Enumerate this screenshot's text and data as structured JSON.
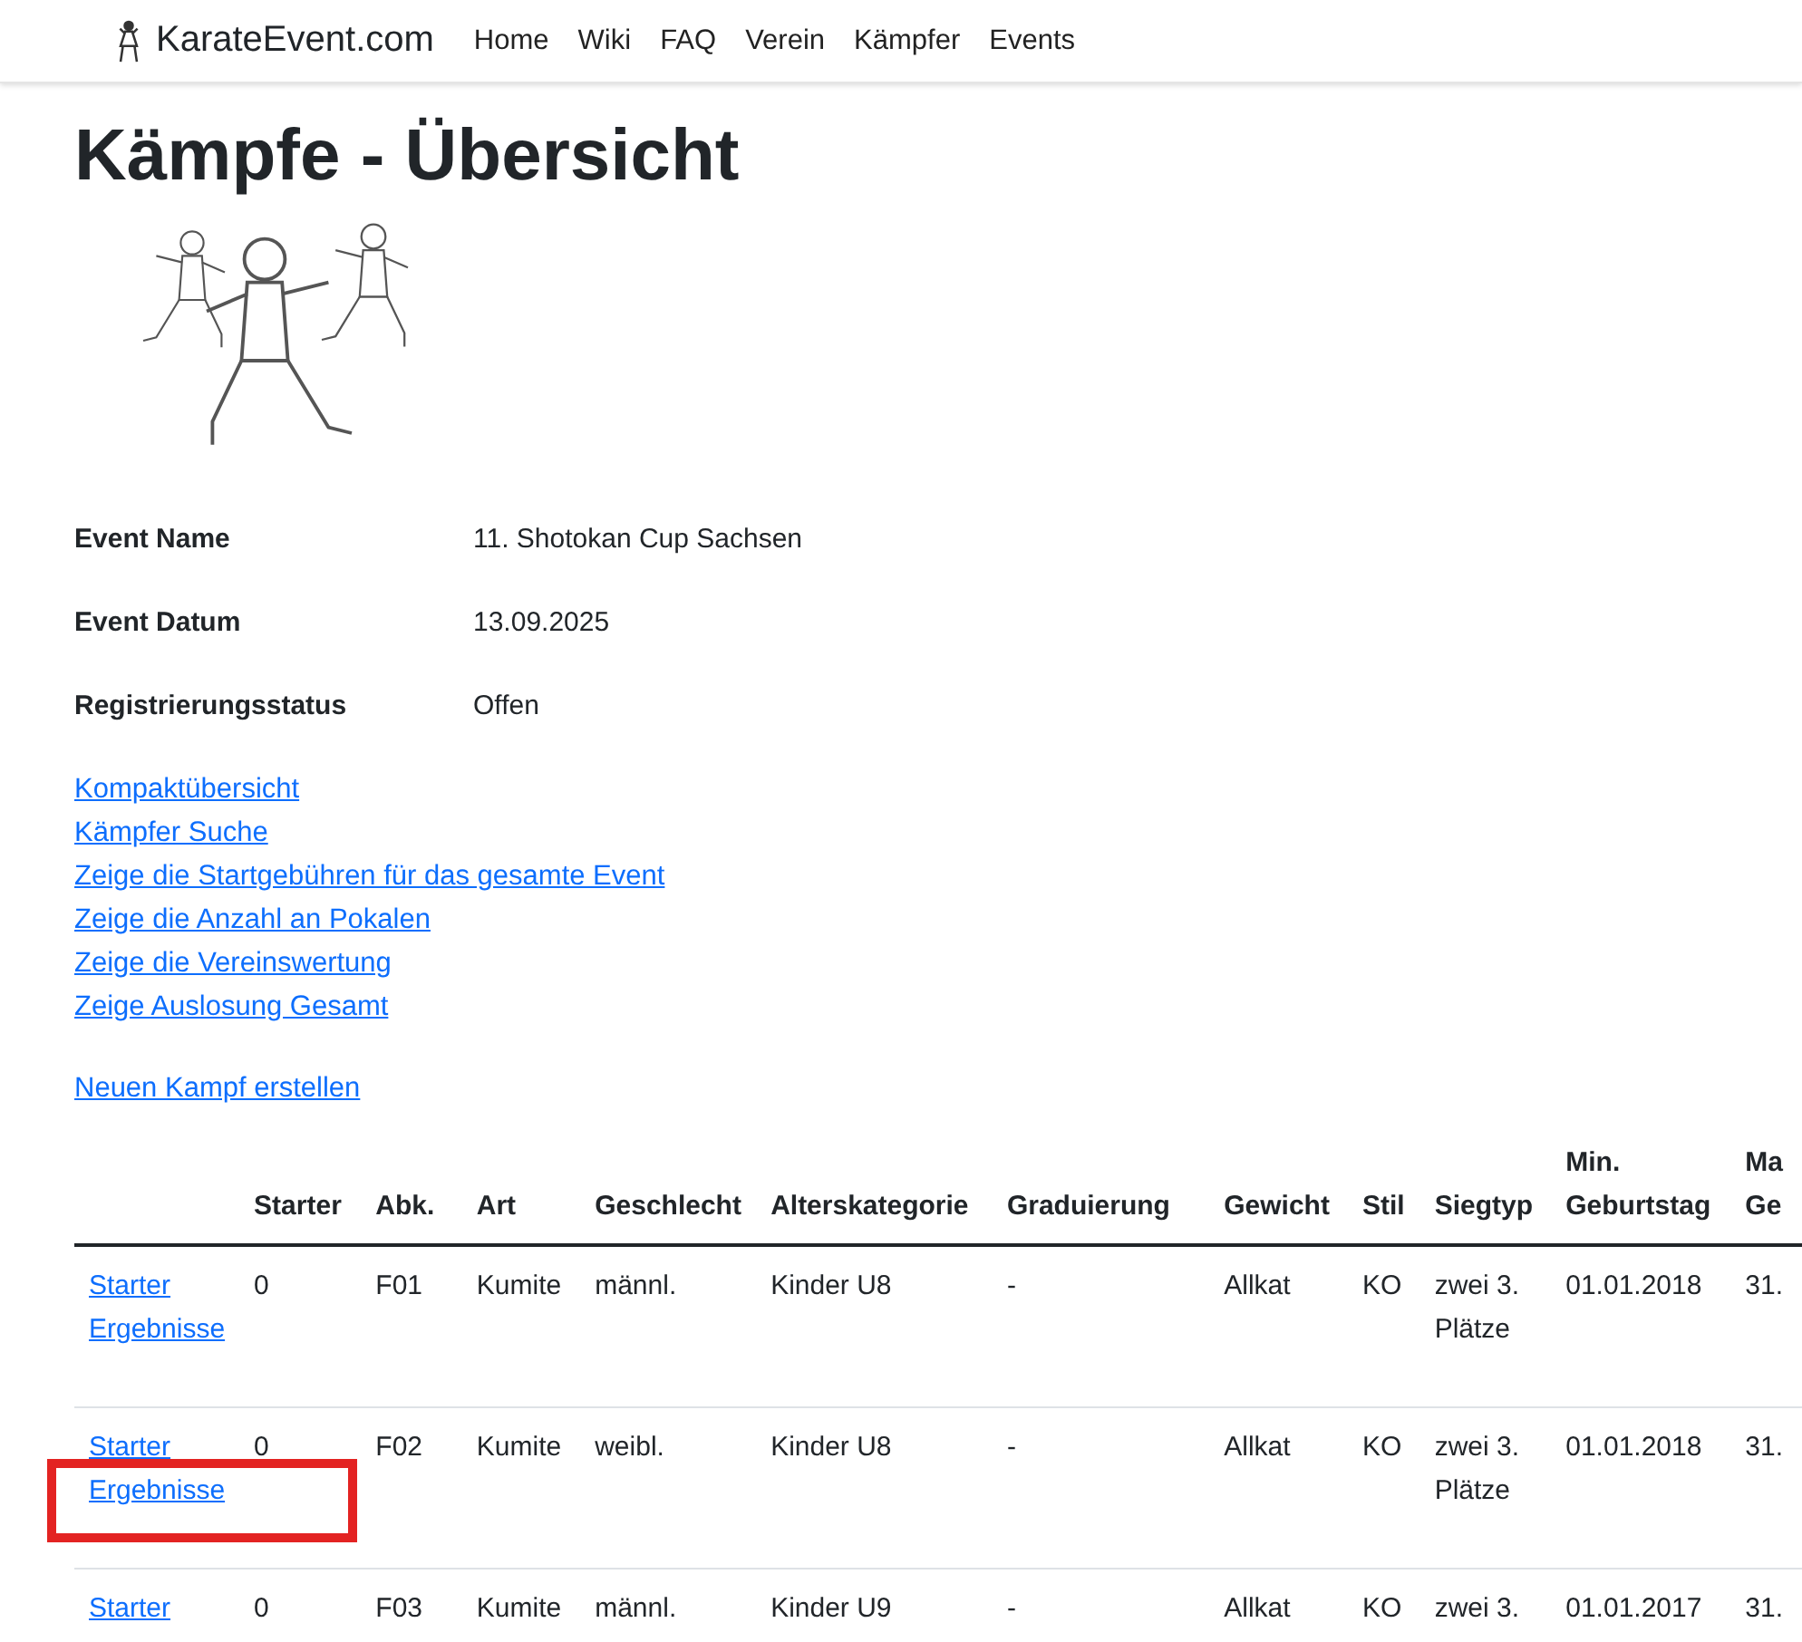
{
  "navbar": {
    "brand": "KarateEvent.com",
    "items": [
      {
        "label": "Home"
      },
      {
        "label": "Wiki"
      },
      {
        "label": "FAQ"
      },
      {
        "label": "Verein"
      },
      {
        "label": "Kämpfer"
      },
      {
        "label": "Events"
      }
    ]
  },
  "title": "Kämpfe - Übersicht",
  "event_info": [
    {
      "label": "Event Name",
      "value": "11. Shotokan Cup Sachsen"
    },
    {
      "label": "Event Datum",
      "value": "13.09.2025"
    },
    {
      "label": "Registrierungsstatus",
      "value": "Offen"
    }
  ],
  "links": [
    "Kompaktübersicht",
    "Kämpfer Suche",
    "Zeige die Startgebühren für das gesamte Event",
    "Zeige die Anzahl an Pokalen",
    "Zeige die Vereinswertung",
    "Zeige Auslosung Gesamt"
  ],
  "create_link": "Neuen Kampf erstellen",
  "table": {
    "columns": [
      "Starter",
      "Abk.",
      "Art",
      "Geschlecht",
      "Alterskategorie",
      "Graduierung",
      "Gewicht",
      "Stil",
      "Siegtyp",
      "Min. Geburtstag",
      "Ma Ge"
    ],
    "rows": [
      {
        "links": [
          "Starter",
          "Ergebnisse"
        ],
        "highlighted": false,
        "cells": [
          "0",
          "F01",
          "Kumite",
          "männl.",
          "Kinder U8",
          "-",
          "Allkat",
          "KO",
          "zwei 3. Plätze",
          "01.01.2018",
          "31."
        ]
      },
      {
        "links": [
          "Starter",
          "Ergebnisse"
        ],
        "highlighted": true,
        "cells": [
          "0",
          "F02",
          "Kumite",
          "weibl.",
          "Kinder U8",
          "-",
          "Allkat",
          "KO",
          "zwei 3. Plätze",
          "01.01.2018",
          "31."
        ]
      },
      {
        "links": [
          "Starter"
        ],
        "highlighted": false,
        "cells": [
          "0",
          "F03",
          "Kumite",
          "männl.",
          "Kinder U9",
          "-",
          "Allkat",
          "KO",
          "zwei 3.",
          "01.01.2017",
          "31."
        ]
      }
    ]
  }
}
